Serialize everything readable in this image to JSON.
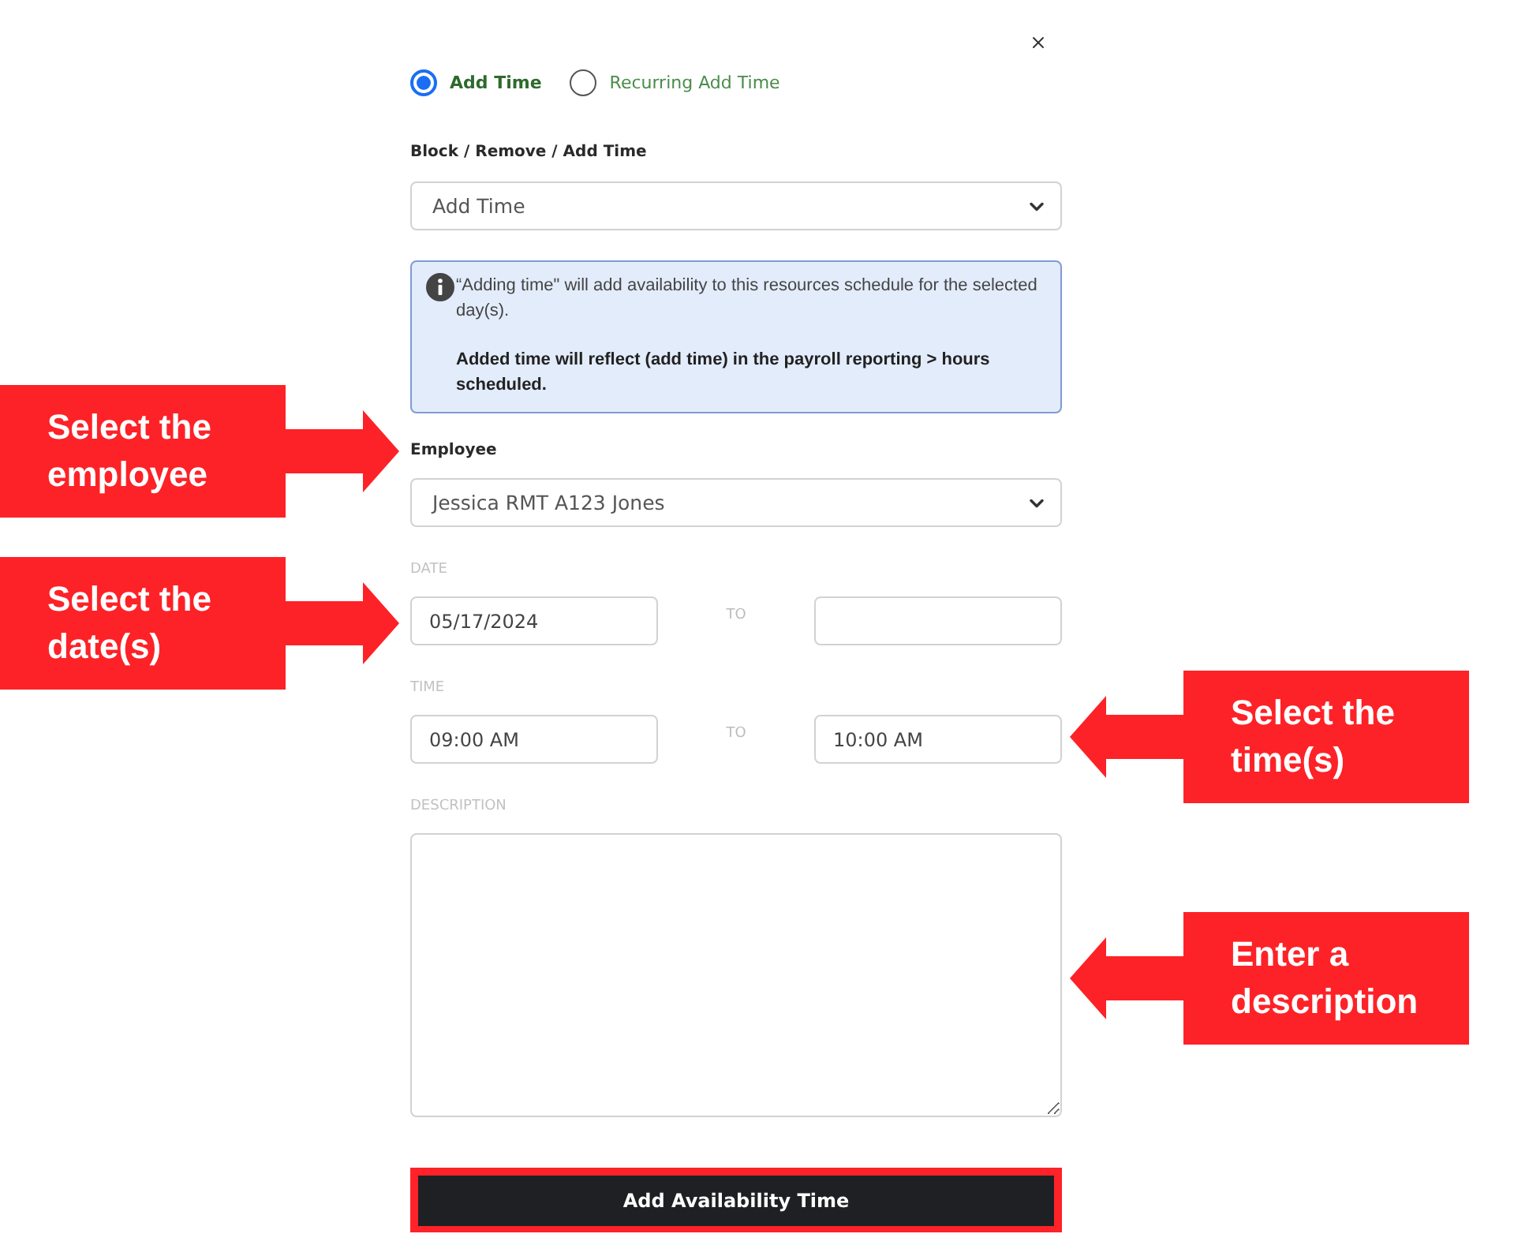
{
  "mode_options": [
    {
      "label": "Add Time",
      "selected": true
    },
    {
      "label": "Recurring Add Time",
      "selected": false
    }
  ],
  "action_field": {
    "label": "Block / Remove / Add Time",
    "value": "Add Time"
  },
  "info_box": {
    "text": "“Adding time\" will add availability to this resources schedule for the selected day(s).",
    "note": "Added time will reflect (add time) in the payroll reporting > hours scheduled."
  },
  "employee_field": {
    "label": "Employee",
    "value": "Jessica RMT A123 Jones"
  },
  "date_range": {
    "label": "DATE",
    "from": "05/17/2024",
    "separator": "TO"
  },
  "time_range": {
    "label": "TIME",
    "from": "09:00 AM",
    "separator": "TO",
    "to": "10:00 AM"
  },
  "description_field": {
    "label": "DESCRIPTION"
  },
  "submit_button": {
    "label": "Add Availability Time"
  },
  "annotations": [
    {
      "text": "Select the employee",
      "kind": "rightward"
    },
    {
      "text": "Select the date(s)",
      "kind": "rightward"
    },
    {
      "text": "Select the time(s)",
      "kind": "leftward"
    },
    {
      "text": "Enter a description",
      "kind": "leftward"
    }
  ]
}
